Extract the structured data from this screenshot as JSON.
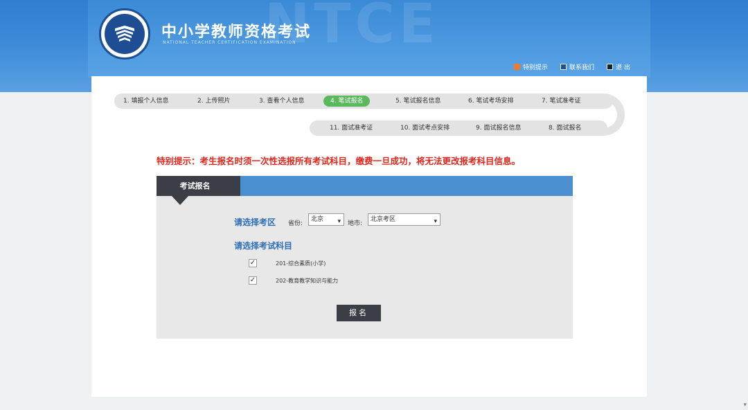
{
  "header": {
    "title": "中小学教师资格考试",
    "subtitle": "NATIONAL TEACHER CERTIFICATION EXAMINATION",
    "watermark": "NTCE",
    "links": [
      {
        "label": "特别提示",
        "icon": "notice-icon"
      },
      {
        "label": "联系我们",
        "icon": "contact-icon"
      },
      {
        "label": "退 出",
        "icon": "exit-icon"
      }
    ]
  },
  "steps": {
    "row1": [
      {
        "label": "1. 填报个人信息",
        "active": false
      },
      {
        "label": "2. 上传照片",
        "active": false
      },
      {
        "label": "3. 查看个人信息",
        "active": false
      },
      {
        "label": "4. 笔试报名",
        "active": true
      },
      {
        "label": "5. 笔试报名信息",
        "active": false
      },
      {
        "label": "6. 笔试考场安排",
        "active": false
      },
      {
        "label": "7. 笔试准考证",
        "active": false
      }
    ],
    "row2": [
      {
        "label": "11. 面试准考证",
        "active": false
      },
      {
        "label": "10. 面试考点安排",
        "active": false
      },
      {
        "label": "9. 面试报名信息",
        "active": false
      },
      {
        "label": "8. 面试报名",
        "active": false
      }
    ]
  },
  "notice": "特别提示：考生报名时须一次性选报所有考试科目，缴费一旦成功，将无法更改报考科目信息。",
  "form": {
    "tab_label": "考试报名",
    "region_label": "请选择考区",
    "province_label": "省份:",
    "province_value": "北京",
    "city_label": "地市:",
    "city_value": "北京考区",
    "subject_label": "请选择考试科目",
    "subjects": [
      {
        "label": "201-综合素质(小学)",
        "checked": true
      },
      {
        "label": "202-教育教学知识与能力",
        "checked": true
      }
    ],
    "submit_label": "报名"
  },
  "colors": {
    "header_blue": "#3c8ad8",
    "active_step": "#5cb85c",
    "notice_red": "#e0261b",
    "tab_dark": "#3b3f45",
    "tabbar_blue": "#4a8fd0",
    "label_blue": "#2e6fb6"
  }
}
